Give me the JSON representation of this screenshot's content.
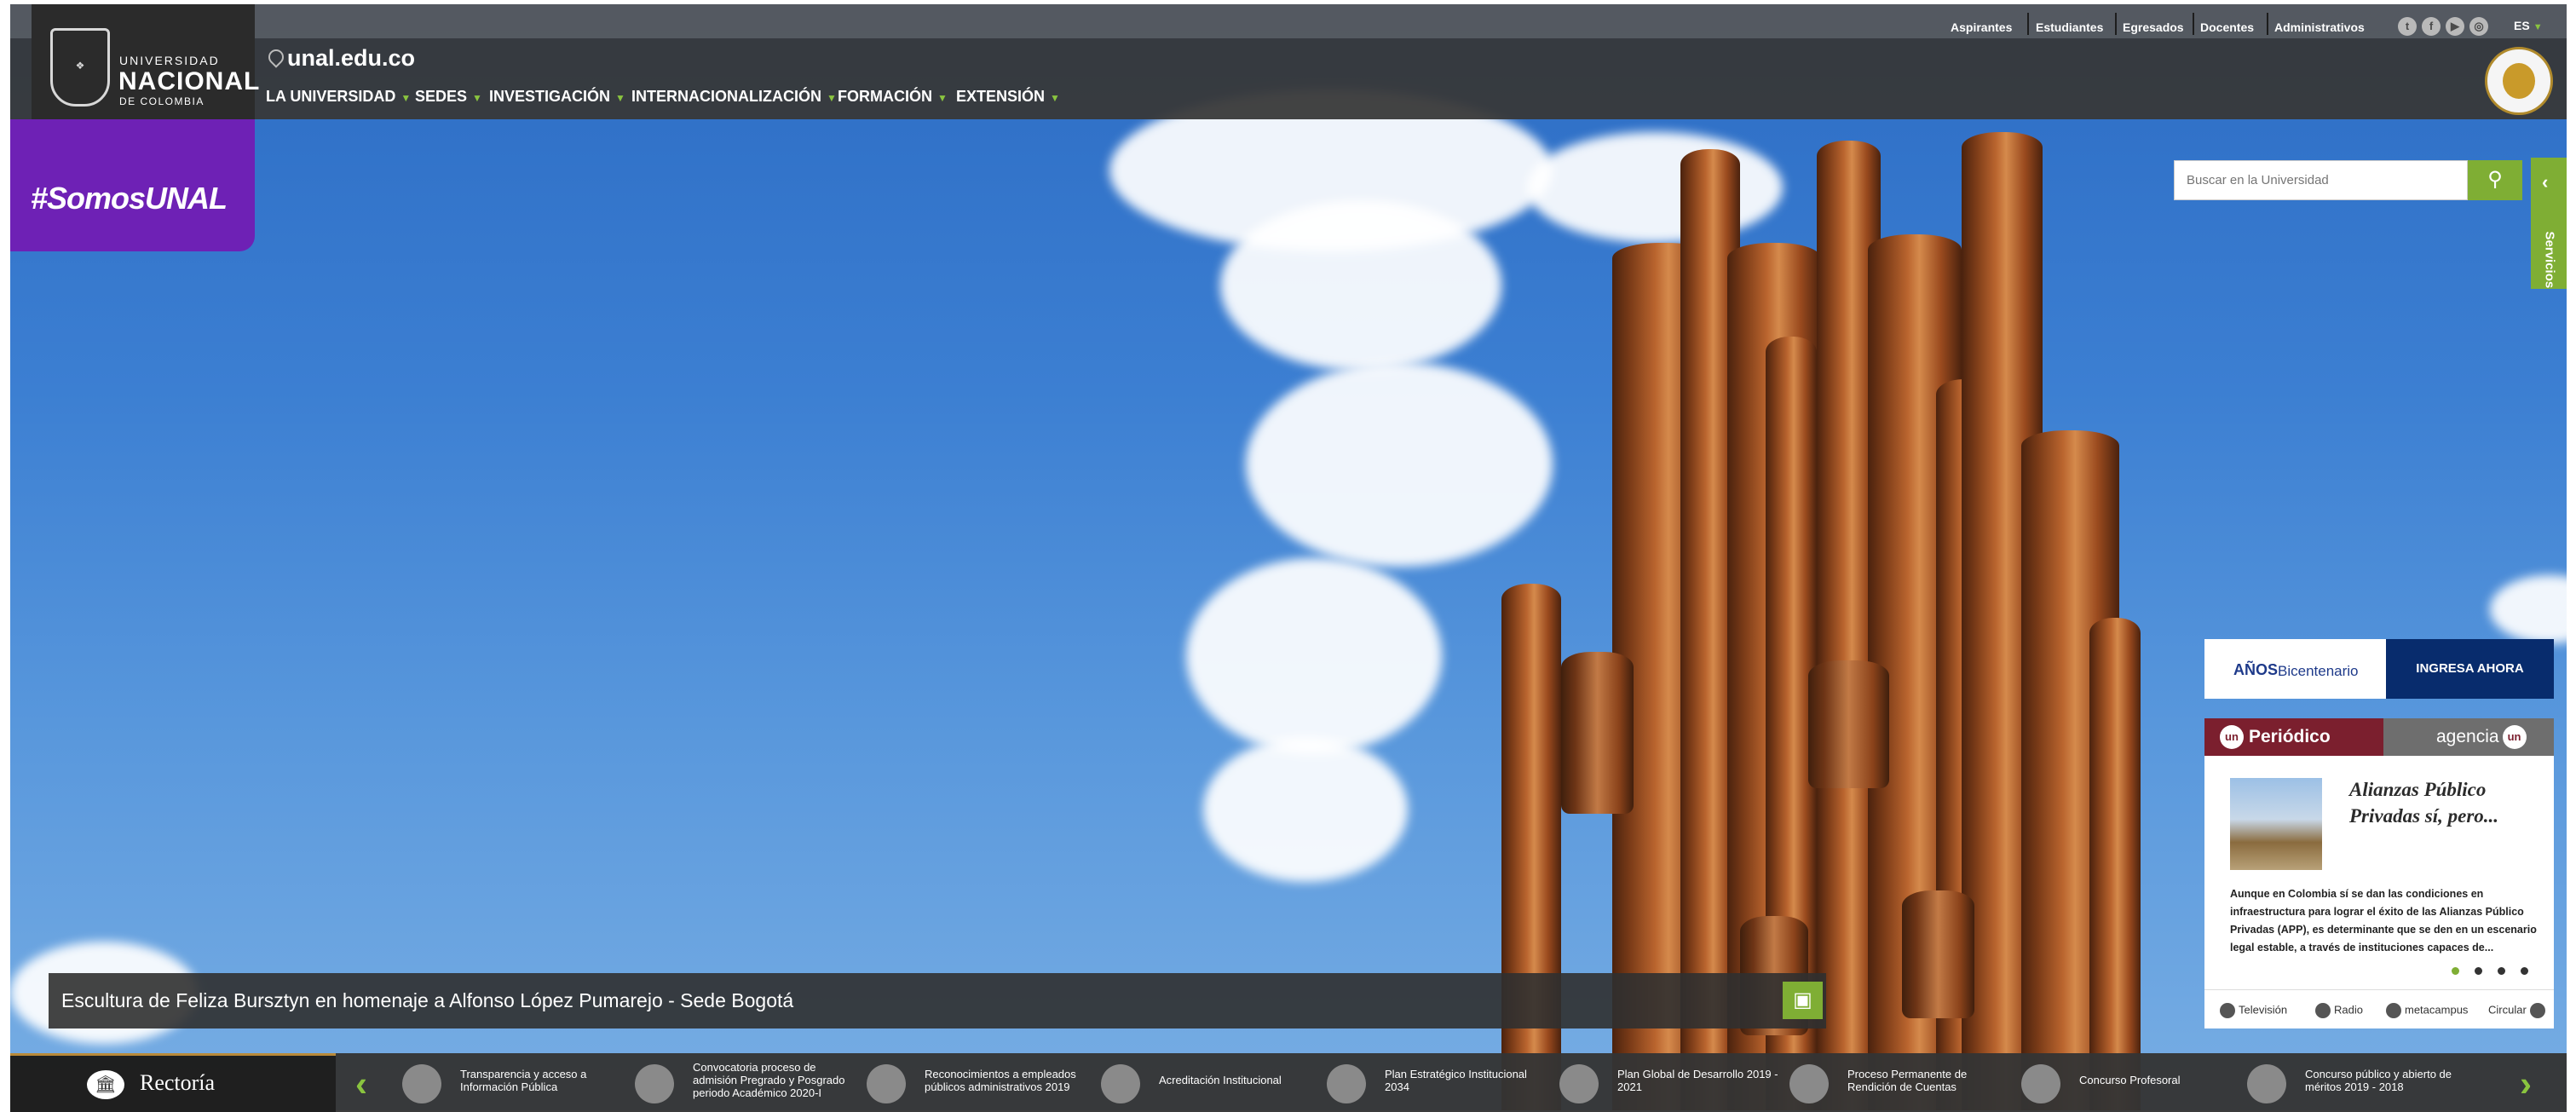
{
  "topbar": {
    "links": [
      "Aspirantes",
      "Estudiantes",
      "Egresados",
      "Docentes",
      "Administrativos"
    ],
    "social_icons": [
      "twitter-icon",
      "facebook-icon",
      "youtube-icon",
      "instagram-icon"
    ],
    "language": "ES"
  },
  "logo": {
    "line1": "UNIVERSIDAD",
    "line2": "NACIONAL",
    "line3": "DE COLOMBIA"
  },
  "banner_tag": "#SomosUNAL",
  "domain": "unal.edu.co",
  "menu": [
    "LA UNIVERSIDAD",
    "SEDES",
    "INVESTIGACIÓN",
    "INTERNACIONALIZACIÓN",
    "FORMACIÓN",
    "EXTENSIÓN"
  ],
  "search": {
    "placeholder": "Buscar en la Universidad"
  },
  "services_tab": "Servicios",
  "bicentenario": {
    "anios": "AÑOS",
    "label": "Bicentenario",
    "cta": "INGRESA AHORA"
  },
  "news": {
    "tab_periodico": "Periódico",
    "tab_agencia": "agencia",
    "title": "Alianzas Público Privadas sí, pero...",
    "body": "Aunque en Colombia sí se dan las condiciones en infraestructura para lograr el éxito de las Alianzas Público Privadas (APP), es determinante que se den en un escenario legal estable, a través de instituciones capaces de...",
    "footer": [
      "Televisión",
      "Radio",
      "metacampus",
      "Circular"
    ]
  },
  "caption": "Escultura de Feliza Bursztyn en homenaje a Alfonso López Pumarejo - Sede Bogotá",
  "bottombar": {
    "rectoria": "Rectoría",
    "links": [
      "Transparencia y acceso a Información Pública",
      "Convocatoria proceso de admisión Pregrado y Posgrado periodo Académico 2020-I",
      "Reconocimientos a empleados públicos administrativos 2019",
      "Acreditación Institucional",
      "Plan Estratégico Institucional 2034",
      "Plan Global de Desarrollo 2019 - 2021",
      "Proceso Permanente de Rendición de Cuentas",
      "Concurso Profesoral",
      "Concurso público y abierto de méritos 2019 - 2018"
    ]
  }
}
